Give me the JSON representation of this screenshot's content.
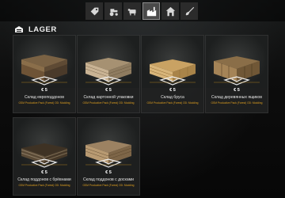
{
  "topbar": {
    "tabs": [
      {
        "icon": "price-tag-icon",
        "active": false
      },
      {
        "icon": "tractor-icon",
        "active": false
      },
      {
        "icon": "animal-icon",
        "active": false
      },
      {
        "icon": "production-icon",
        "active": true
      },
      {
        "icon": "house-icon",
        "active": false
      },
      {
        "icon": "shovel-icon",
        "active": false
      }
    ]
  },
  "category": {
    "title": "LAGER",
    "icon": "storage-icon"
  },
  "items": [
    {
      "name": "Склад европоддонов",
      "price": "€ 5",
      "source": "GSM Productive Pack (Forest) OD: Modding",
      "icon": "euro-pallet-stack-icon"
    },
    {
      "name": "Склад картонной упаковки",
      "price": "€ 5",
      "source": "GSM Productive Pack (Forest) OD: Modding",
      "icon": "cardboard-pallet-stack-icon"
    },
    {
      "name": "Склад бруса",
      "price": "€ 5",
      "source": "GSM Productive Pack (Forest) OD: Modding",
      "icon": "timber-beam-stack-icon"
    },
    {
      "name": "Склад деревянных ящиков",
      "price": "€ 5",
      "source": "GSM Productive Pack (Forest) OD: Modding",
      "icon": "wooden-crate-stack-icon"
    },
    {
      "name": "Склад поддонов с брёвнами",
      "price": "€ 5",
      "source": "GSM Productive Pack (Forest) OD: Modding",
      "icon": "log-pallet-stack-icon"
    },
    {
      "name": "Склад поддонов с досками",
      "price": "€ 5",
      "source": "GSM Productive Pack (Forest) OD: Modding",
      "icon": "plank-pallet-stack-icon"
    }
  ],
  "colors": {
    "accent": "#e0a020",
    "marker": "#f0f0f0"
  }
}
